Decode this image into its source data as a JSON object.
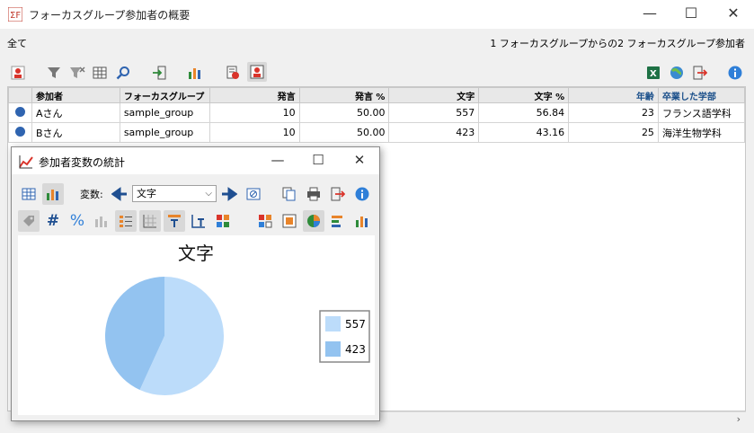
{
  "window": {
    "title": "フォーカスグループ参加者の概要",
    "minimize": "—",
    "maximize": "☐",
    "close": "✕"
  },
  "filter": {
    "left": "全て",
    "right": "1 フォーカスグループからの2 フォーカスグループ参加者"
  },
  "table": {
    "headers": [
      "参加者",
      "フォーカスグループ",
      "発言",
      "発言 %",
      "文字",
      "文字 %",
      "年齢",
      "卒業した学部"
    ],
    "rows": [
      [
        "Aさん",
        "sample_group",
        "10",
        "50.00",
        "557",
        "56.84",
        "23",
        "フランス語学科"
      ],
      [
        "Bさん",
        "sample_group",
        "10",
        "50.00",
        "423",
        "43.16",
        "25",
        "海洋生物学科"
      ]
    ]
  },
  "dialog": {
    "title": "参加者変数の統計",
    "variable_label": "変数:",
    "variable_value": "文字"
  },
  "chart_data": {
    "type": "pie",
    "title": "文字",
    "categories": [
      "557",
      "423"
    ],
    "values": [
      557,
      423
    ],
    "colors": [
      "#bcdcfa",
      "#93c3f0"
    ],
    "legend": "right"
  },
  "colors": {
    "accent_blue": "#2f64b0",
    "excel_green": "#1e7145",
    "orange": "#e8842a",
    "red": "#d9342b"
  }
}
